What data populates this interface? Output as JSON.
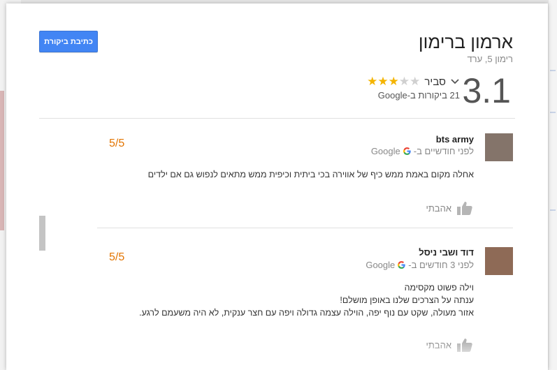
{
  "header": {
    "write_review_label": "כתיבת ביקורת",
    "place_name": "ארמון ברימון",
    "address": "רימון 5, ערד",
    "rating_value": "3.1",
    "stars_filled": 3,
    "stars_total": 5,
    "rating_label": "סביר",
    "review_count": "21 ביקורות ב-Google"
  },
  "reviews": [
    {
      "author": "bts army",
      "time_source": "לפני חודשיים ב-",
      "source": "Google",
      "score": "5/5",
      "text": [
        "אחלה מקום באמת ממש כיף של אווירה בכי ביתית וכיפית ממש מתאים לנפוש גם אם ילדים"
      ],
      "like_label": "אהבתי",
      "avatar_color": "#84746a"
    },
    {
      "author": "דוד ושבי ניסל",
      "time_source": "לפני 3 חודשים ב-",
      "source": "Google",
      "score": "5/5",
      "text": [
        "וילה פשוט מקסימה",
        "ענתה על הצרכים שלנו באופן מושלם!",
        "אזור מעולה, שקט עם נוף יפה, הוילה עצמה גדולה ויפה עם חצר ענקית, לא היה משעמם לרגע."
      ],
      "like_label": "אהבתי",
      "avatar_color": "#8e6a56"
    }
  ],
  "colors": {
    "accent": "#4285f4",
    "star": "#f4b400",
    "score": "#e37400"
  }
}
